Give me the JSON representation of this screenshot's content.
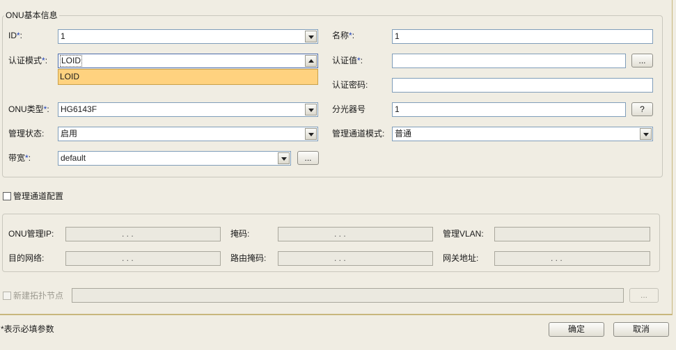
{
  "basic_info": {
    "legend": "ONU基本信息",
    "id_label": "ID",
    "id_value": "1",
    "name_label": "名称",
    "name_value": "1",
    "auth_mode_label": "认证模式",
    "auth_mode_value": "LOID",
    "auth_mode_options": [
      "LOID"
    ],
    "auth_value_label": "认证值",
    "auth_value_value": "",
    "auth_password_label": "认证密码:",
    "auth_password_value": "",
    "onu_type_label": "ONU类型",
    "onu_type_value": "HG6143F",
    "splitter_label": "分光器号",
    "splitter_value": "1",
    "admin_state_label": "管理状态:",
    "admin_state_value": "启用",
    "mgmt_channel_mode_label": "管理通道模式:",
    "mgmt_channel_mode_value": "普通",
    "bandwidth_label": "带宽",
    "bandwidth_value": "default",
    "required_mark": "*",
    "colon": ":",
    "browse_label": "...",
    "help_label": "?"
  },
  "mgmt_channel": {
    "checkbox_label": "管理通道配置",
    "checked": false,
    "onu_mgmt_ip_label": "ONU管理IP:",
    "mask_label": "掩码:",
    "mgmt_vlan_label": "管理VLAN:",
    "dest_network_label": "目的网络:",
    "route_mask_label": "路由掩码:",
    "gateway_label": "网关地址:",
    "ip_placeholder": ". . ."
  },
  "topology": {
    "checkbox_label": "新建拓扑节点",
    "checked": false,
    "browse_label": "..."
  },
  "footer": {
    "note": "*表示必填参数",
    "ok_label": "确定",
    "cancel_label": "取消"
  }
}
